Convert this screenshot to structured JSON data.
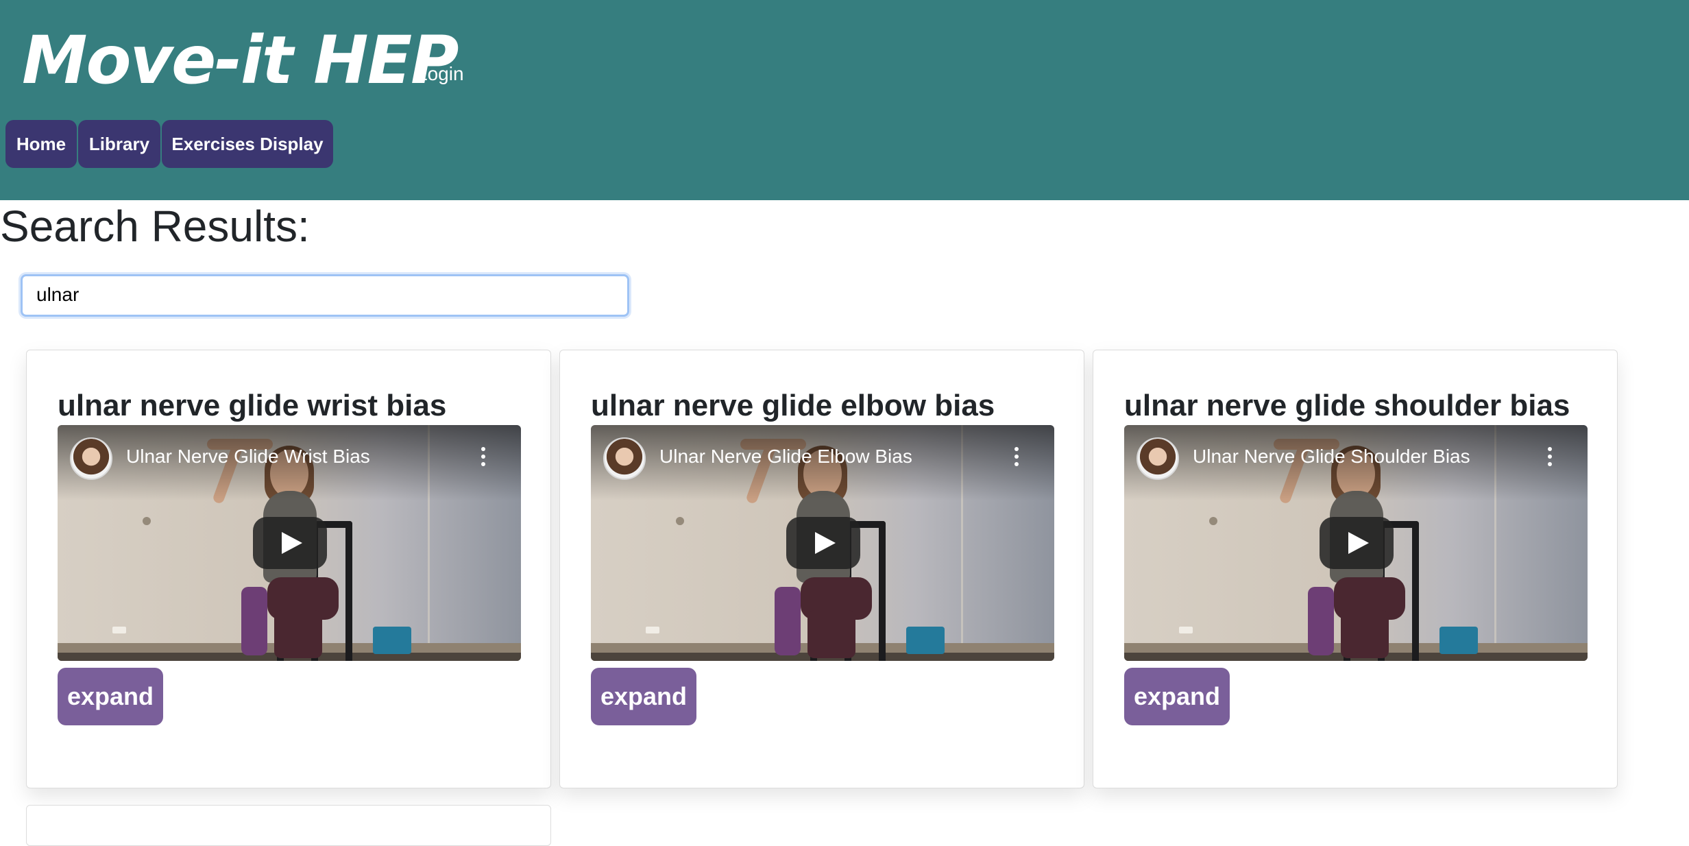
{
  "header": {
    "brand": "Move-it HEP",
    "login_label": "Login",
    "nav": [
      {
        "label": "Home"
      },
      {
        "label": "Library"
      },
      {
        "label": "Exercises Display"
      }
    ]
  },
  "page_title": "Search Results:",
  "search": {
    "value": "ulnar"
  },
  "results": [
    {
      "title": "ulnar nerve glide wrist bias",
      "video_title": "Ulnar Nerve Glide Wrist Bias",
      "button_label": "expand"
    },
    {
      "title": "ulnar nerve glide elbow bias",
      "video_title": "Ulnar Nerve Glide Elbow Bias",
      "button_label": "expand"
    },
    {
      "title": "ulnar nerve glide shoulder bias",
      "video_title": "Ulnar Nerve Glide Shoulder Bias",
      "button_label": "expand"
    }
  ],
  "colors": {
    "header_bg": "#367e7f",
    "nav_button_bg": "#3b3670",
    "expand_button_bg": "#7a5f9a"
  },
  "icons": {
    "play": "play-icon",
    "more": "more-vertical-icon",
    "avatar": "channel-avatar"
  }
}
